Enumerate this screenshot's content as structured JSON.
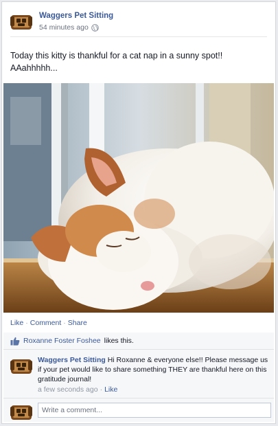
{
  "post": {
    "page_name": "Waggers Pet Sitting",
    "timestamp": "54 minutes ago",
    "privacy_icon": "globe-icon",
    "text": "Today this kitty is thankful for a cat nap in a sunny spot!! AAahhhhh...",
    "photo_icon": "sleeping-cat-photo"
  },
  "actions": {
    "like_label": "Like",
    "comment_label": "Comment",
    "share_label": "Share",
    "separator": "·"
  },
  "likes": {
    "icon": "thumbs-up-icon",
    "name": "Roxanne Foster Foshee",
    "suffix": "likes this."
  },
  "comment": {
    "author": "Waggers Pet Sitting",
    "text": "Hi Roxanne & everyone else!! Please message us if your pet would like to share something THEY are thankful here on this gratitude journal!",
    "timestamp": "a few seconds ago",
    "like_label": "Like"
  },
  "compose": {
    "placeholder": "Write a comment...",
    "value": ""
  },
  "colors": {
    "link": "#3b5998",
    "meta": "#6a7180",
    "ufi_bg": "#f6f7f9"
  }
}
